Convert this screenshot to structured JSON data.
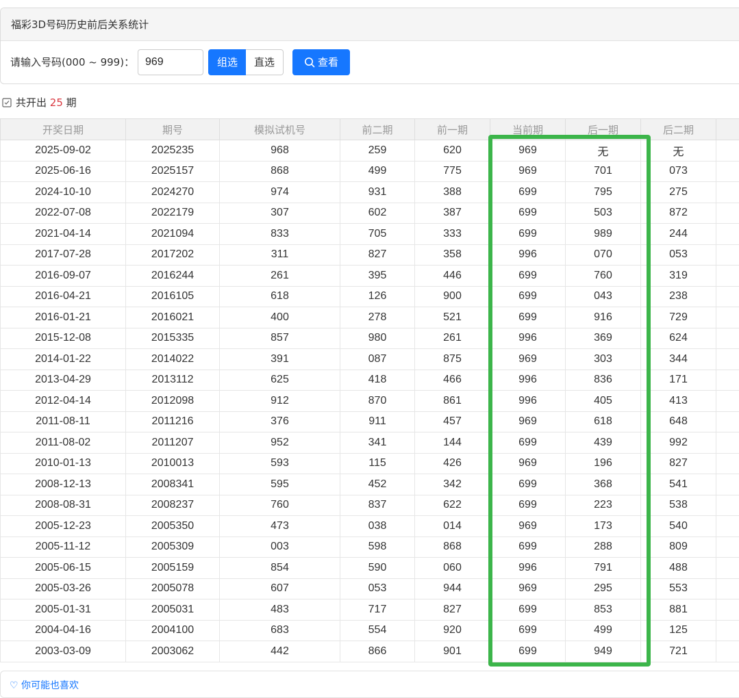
{
  "panel": {
    "title": "福彩3D号码历史前后关系统计",
    "input_label": "请输入号码(000 ~ 999)：",
    "input_value": "969",
    "mode_group": "组选",
    "mode_direct": "直选",
    "search_label": "查看"
  },
  "summary": {
    "prefix": "共开出",
    "count": "25",
    "suffix": "期"
  },
  "table": {
    "headers": [
      "开奖日期",
      "期号",
      "模拟试机号",
      "前二期",
      "前一期",
      "当前期",
      "后一期",
      "后二期"
    ],
    "rows": [
      [
        "2025-09-02",
        "2025235",
        "968",
        "259",
        "620",
        "969",
        "无",
        "无"
      ],
      [
        "2025-06-16",
        "2025157",
        "868",
        "499",
        "775",
        "969",
        "701",
        "073"
      ],
      [
        "2024-10-10",
        "2024270",
        "974",
        "931",
        "388",
        "699",
        "795",
        "275"
      ],
      [
        "2022-07-08",
        "2022179",
        "307",
        "602",
        "387",
        "699",
        "503",
        "872"
      ],
      [
        "2021-04-14",
        "2021094",
        "833",
        "705",
        "333",
        "699",
        "989",
        "244"
      ],
      [
        "2017-07-28",
        "2017202",
        "311",
        "827",
        "358",
        "996",
        "070",
        "053"
      ],
      [
        "2016-09-07",
        "2016244",
        "261",
        "395",
        "446",
        "699",
        "760",
        "319"
      ],
      [
        "2016-04-21",
        "2016105",
        "618",
        "126",
        "900",
        "699",
        "043",
        "238"
      ],
      [
        "2016-01-21",
        "2016021",
        "400",
        "278",
        "521",
        "699",
        "916",
        "729"
      ],
      [
        "2015-12-08",
        "2015335",
        "857",
        "980",
        "261",
        "996",
        "369",
        "624"
      ],
      [
        "2014-01-22",
        "2014022",
        "391",
        "087",
        "875",
        "969",
        "303",
        "344"
      ],
      [
        "2013-04-29",
        "2013112",
        "625",
        "418",
        "466",
        "996",
        "836",
        "171"
      ],
      [
        "2012-04-14",
        "2012098",
        "912",
        "870",
        "861",
        "996",
        "405",
        "413"
      ],
      [
        "2011-08-11",
        "2011216",
        "376",
        "911",
        "457",
        "969",
        "618",
        "648"
      ],
      [
        "2011-08-02",
        "2011207",
        "952",
        "341",
        "144",
        "699",
        "439",
        "992"
      ],
      [
        "2010-01-13",
        "2010013",
        "593",
        "115",
        "426",
        "969",
        "196",
        "827"
      ],
      [
        "2008-12-13",
        "2008341",
        "595",
        "452",
        "342",
        "699",
        "368",
        "541"
      ],
      [
        "2008-08-31",
        "2008237",
        "760",
        "837",
        "622",
        "699",
        "223",
        "538"
      ],
      [
        "2005-12-23",
        "2005350",
        "473",
        "038",
        "014",
        "969",
        "173",
        "540"
      ],
      [
        "2005-11-12",
        "2005309",
        "003",
        "598",
        "868",
        "699",
        "288",
        "809"
      ],
      [
        "2005-06-15",
        "2005159",
        "854",
        "590",
        "060",
        "996",
        "791",
        "488"
      ],
      [
        "2005-03-26",
        "2005078",
        "607",
        "053",
        "944",
        "969",
        "295",
        "553"
      ],
      [
        "2005-01-31",
        "2005031",
        "483",
        "717",
        "827",
        "699",
        "853",
        "881"
      ],
      [
        "2004-04-16",
        "2004100",
        "683",
        "554",
        "920",
        "699",
        "499",
        "125"
      ],
      [
        "2003-03-09",
        "2003062",
        "442",
        "866",
        "901",
        "699",
        "949",
        "721"
      ]
    ]
  },
  "footer": {
    "text": "你可能也喜欢"
  },
  "colors": {
    "accent": "#1677ff",
    "highlight": "#3cb54a",
    "count": "#d9363e"
  }
}
